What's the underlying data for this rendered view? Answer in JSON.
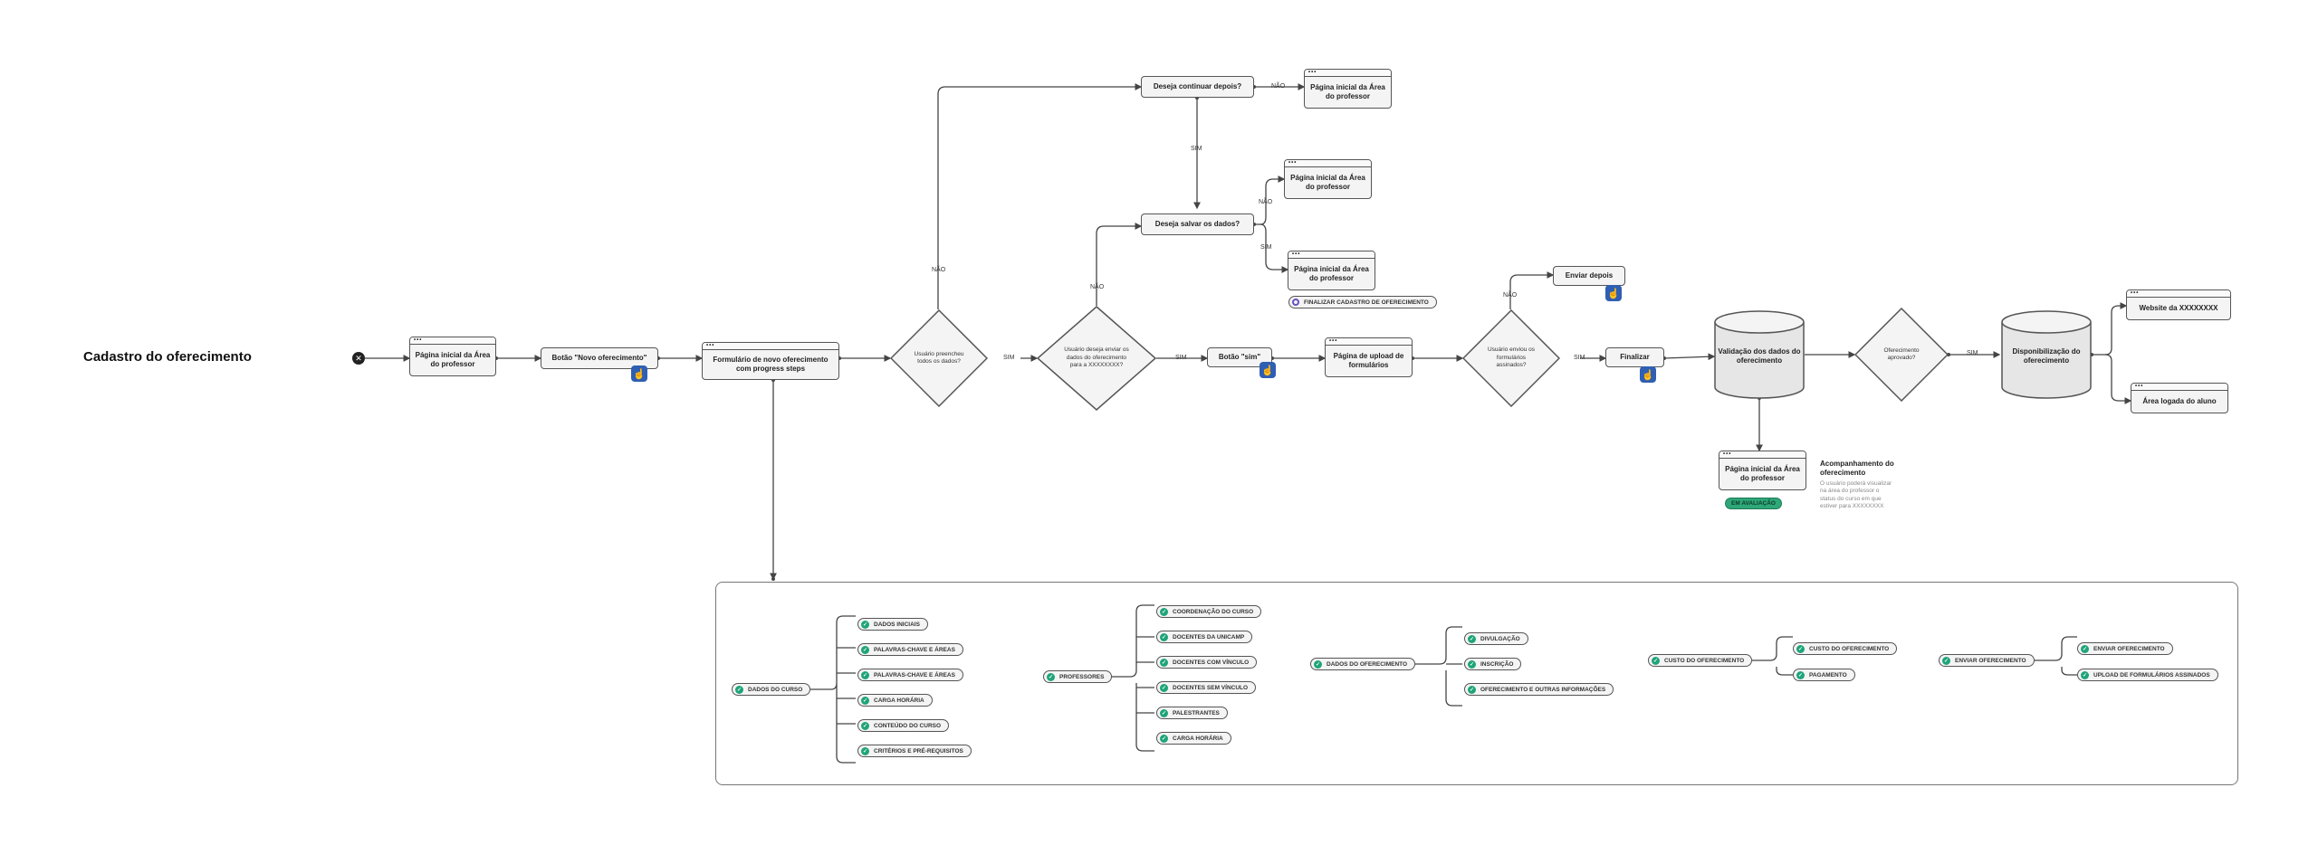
{
  "title": "Cadastro do oferecimento",
  "colors": {
    "accent_blue": "#2f5fb3",
    "check_green": "#1fa47a",
    "radio_purple": "#6a4fc6",
    "stroke": "#555555"
  },
  "nodes": {
    "home1": "Página inicial da Área do professor",
    "new_button": "Botão \"Novo oferecimento\"",
    "form": "Formulário de novo oferecimento com progress steps",
    "d_filled": "Usuário preencheu todos os dados?",
    "d_send": "Usuário deseja enviar os dados do oferecimento para a XXXXXXXX?",
    "continue_later": "Deseja continuar depois?",
    "home_top": "Página inicial da Área do professor",
    "save_data": "Deseja salvar os dados?",
    "home_save_no": "Página inicial da Área do professor",
    "home_save_yes": "Página inicial da Área do professor",
    "finalize_tag": "FINALIZAR CADASTRO DE OFERECIMENTO",
    "btn_sim": "Botão \"sim\"",
    "upload_page": "Página de upload de formulários",
    "d_forms": "Usuário enviou os formulários assinados?",
    "send_later": "Enviar depois",
    "finalizar": "Finalizar",
    "validation": "Validação dos dados do oferecimento",
    "d_approved": "Oferecimento aprovado?",
    "availability": "Disponibilização do oferecimento",
    "website": "Website da XXXXXXXX",
    "student_area": "Área logada do aluno",
    "home_tracking": "Página inicial da Área do professor",
    "status_badge": "EM AVALIAÇÃO",
    "tracking_title": "Acompanhamento do oferecimento",
    "tracking_text": "O usuário poderá visualizar na área do professor o status do curso em que estiver para XXXXXXXX"
  },
  "labels": {
    "sim": "SIM",
    "nao": "NÃO"
  },
  "groups": [
    {
      "root": "DADOS DO CURSO",
      "items": [
        "DADOS INICIAIS",
        "PALAVRAS-CHAVE E ÁREAS",
        "PALAVRAS-CHAVE E ÁREAS",
        "CARGA HORÁRIA",
        "CONTEÚDO DO CURSO",
        "CRITÉRIOS E PRÉ-REQUISITOS"
      ]
    },
    {
      "root": "PROFESSORES",
      "items": [
        "COORDENAÇÃO DO CURSO",
        "DOCENTES DA UNICAMP",
        "DOCENTES COM VÍNCULO",
        "DOCENTES SEM VÍNCULO",
        "PALESTRANTES",
        "CARGA HORÁRIA"
      ]
    },
    {
      "root": "DADOS DO OFERECIMENTO",
      "items": [
        "DIVULGAÇÃO",
        "INSCRIÇÃO",
        "OFERECIMENTO E OUTRAS INFORMAÇÕES"
      ]
    },
    {
      "root": "CUSTO DO OFERECIMENTO",
      "items": [
        "CUSTO DO OFERECIMENTO",
        "PAGAMENTO"
      ]
    },
    {
      "root": "ENVIAR OFERECIMENTO",
      "items": [
        "ENVIAR OFERECIMENTO",
        "UPLOAD DE FORMULÁRIOS ASSINADOS"
      ]
    }
  ]
}
